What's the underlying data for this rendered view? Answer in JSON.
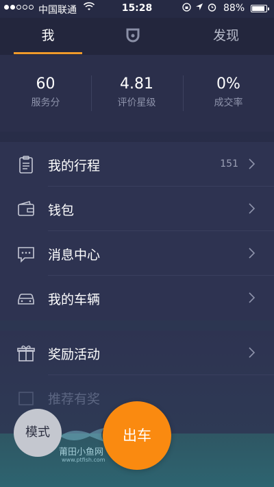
{
  "status_bar": {
    "carrier": "中国联通",
    "time": "15:28",
    "battery": "88%",
    "battery_level": 0.88
  },
  "tabs": {
    "me": "我",
    "discover": "发现"
  },
  "stats": [
    {
      "value": "60",
      "label": "服务分"
    },
    {
      "value": "4.81",
      "label": "评价星级"
    },
    {
      "value": "0%",
      "label": "成交率"
    }
  ],
  "menu": {
    "trips": {
      "label": "我的行程",
      "count": "151",
      "icon": "clipboard-icon"
    },
    "wallet": {
      "label": "钱包",
      "icon": "wallet-icon"
    },
    "messages": {
      "label": "消息中心",
      "icon": "message-icon"
    },
    "vehicle": {
      "label": "我的车辆",
      "icon": "car-icon"
    },
    "rewards": {
      "label": "奖励活动",
      "icon": "gift-icon"
    },
    "partial": {
      "label": "推荐有奖"
    }
  },
  "bottom": {
    "mode_label": "模式",
    "go_label": "出车"
  },
  "watermark": {
    "text": "莆田小鱼网",
    "url": "www.ptfish.com"
  },
  "colors": {
    "accent": "#f09a2a",
    "go_button": "#fa8a10",
    "background": "#2a2f4a"
  }
}
